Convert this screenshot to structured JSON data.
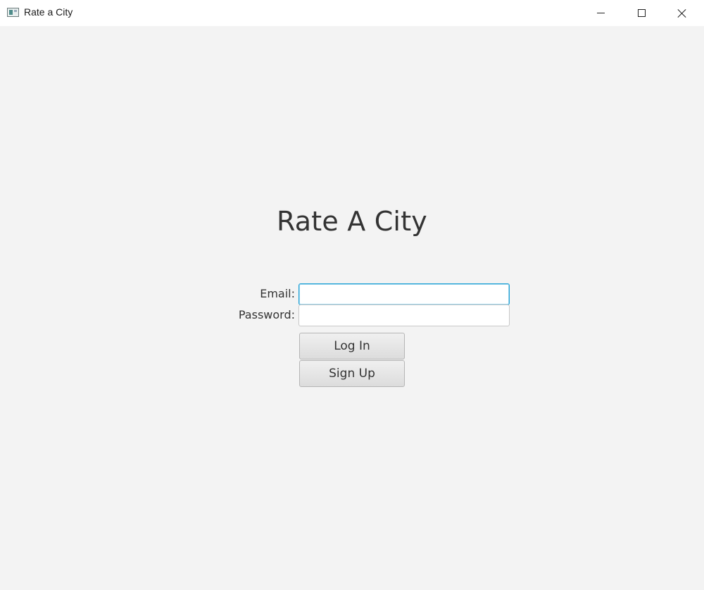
{
  "window": {
    "title": "Rate a City",
    "icon": "app-icon",
    "controls": [
      "minimize-icon",
      "maximize-icon",
      "close-icon"
    ]
  },
  "main": {
    "heading": "Rate A City",
    "email_label": "Email:",
    "email_value": "",
    "password_label": "Password:",
    "password_value": "",
    "login_label": "Log In",
    "signup_label": "Sign Up"
  },
  "colors": {
    "background": "#f3f3f3",
    "focus_border": "#1b9fd6",
    "text": "#333333"
  }
}
